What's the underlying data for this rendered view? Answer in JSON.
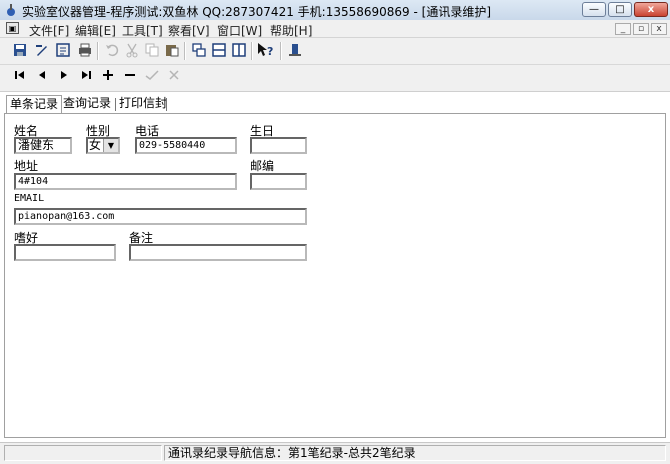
{
  "window": {
    "title": "实验室仪器管理-程序测试:双鱼林  QQ:287307421 手机:13558690869 - [通讯录维护]",
    "minimize_label": "—",
    "maximize_label": "□",
    "close_label": "x"
  },
  "menu": {
    "items": [
      "文件[F]",
      "编辑[E]",
      "工具[T]",
      "察看[V]",
      "窗口[W]",
      "帮助[H]"
    ],
    "mdi_controls": [
      "_",
      "▫",
      "x"
    ]
  },
  "toolbar1": {
    "icons": [
      "save-icon",
      "edit-icon",
      "properties-icon",
      "print-preview-icon",
      "undo-icon",
      "cut-icon",
      "copy-icon",
      "paste-icon",
      "cascade-windows-icon",
      "tile-horizontal-icon",
      "tile-vertical-icon",
      "context-help-icon",
      "exit-icon"
    ]
  },
  "toolbar2": {
    "icons": [
      "first-record-icon",
      "prev-record-icon",
      "next-record-icon",
      "last-record-icon",
      "add-record-icon",
      "delete-record-icon",
      "post-edit-icon",
      "cancel-edit-icon"
    ]
  },
  "tabs": [
    "单条记录",
    "查询记录",
    "打印信封"
  ],
  "form": {
    "name_label": "姓名",
    "name_value": "潘健东",
    "gender_label": "性别",
    "gender_value": "女",
    "phone_label": "电话",
    "phone_value": "029-5580440",
    "birthday_label": "生日",
    "birthday_value": "",
    "address_label": "地址",
    "address_value": "4#104",
    "zip_label": "邮编",
    "zip_value": "",
    "email_label": "EMAIL",
    "email_value": "pianopan@163.com",
    "hobby_label": "嗜好",
    "hobby_value": "",
    "note_label": "备注",
    "note_value": ""
  },
  "status": {
    "pane1": "",
    "pane2": "通讯录纪录导航信息：第1笔纪录-总共2笔纪录"
  }
}
